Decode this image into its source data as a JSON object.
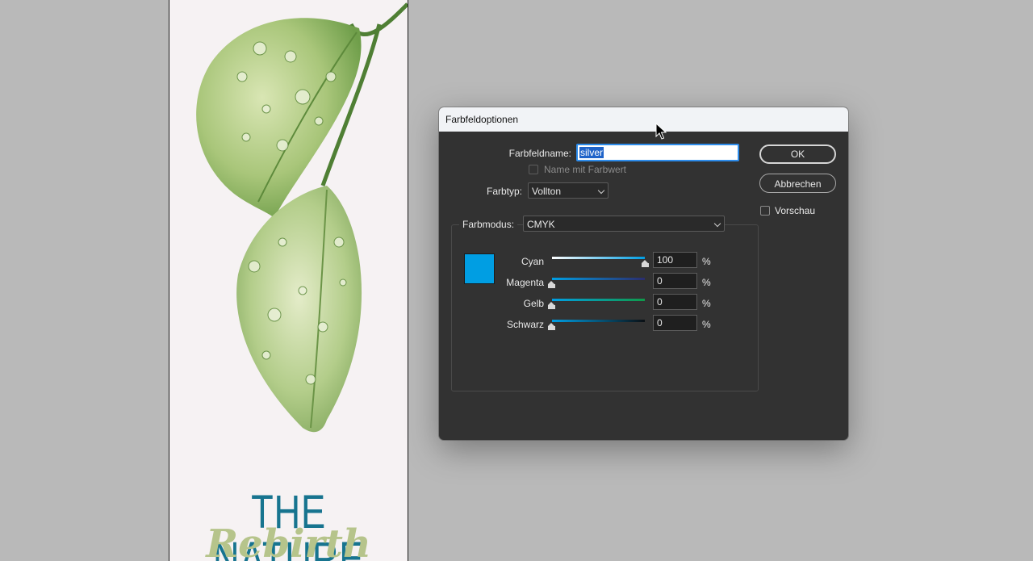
{
  "document": {
    "title_text": "THE NATURE",
    "script_text": "Rebirth"
  },
  "dialog": {
    "title": "Farbfeldoptionen",
    "swatch_name_label": "Farbfeldname:",
    "swatch_name_value": "silver",
    "name_with_value_label": "Name mit Farbwert",
    "name_with_value_checked": false,
    "color_type_label": "Farbtyp:",
    "color_type_value": "Vollton",
    "color_mode_label": "Farbmodus:",
    "color_mode_value": "CMYK",
    "ok_label": "OK",
    "cancel_label": "Abbrechen",
    "preview_label": "Vorschau",
    "preview_checked": false,
    "swatch_color": "#009ee3",
    "percent_symbol": "%",
    "channels": [
      {
        "name": "Cyan",
        "value": "100"
      },
      {
        "name": "Magenta",
        "value": "0"
      },
      {
        "name": "Gelb",
        "value": "0"
      },
      {
        "name": "Schwarz",
        "value": "0"
      }
    ]
  },
  "colors": {
    "accent": "#2d8ceb",
    "dialog_bg": "#323232",
    "title_text": "#17748f"
  },
  "icons": {
    "cursor": "arrow-cursor-icon",
    "dropdown": "chevron-down-icon"
  }
}
